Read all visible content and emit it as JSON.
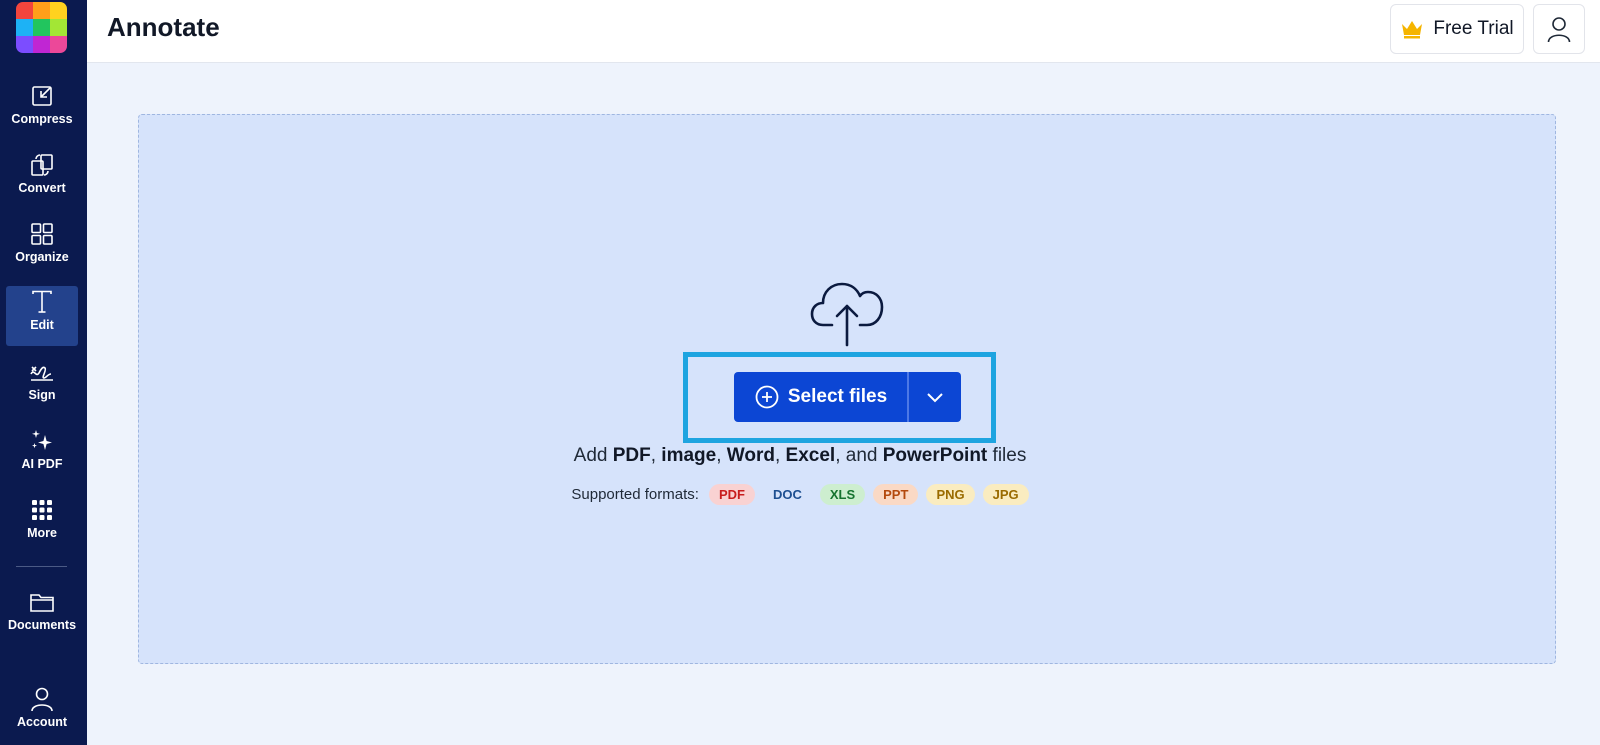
{
  "app": {
    "title": "Annotate"
  },
  "sidebar": {
    "logo_colors": [
      "#f2453d",
      "#ff9f1a",
      "#ffd21f",
      "#1db2f5",
      "#22c55e",
      "#a3e635",
      "#7c4dff",
      "#c026d3",
      "#ec4899"
    ],
    "items": [
      {
        "label": "Compress",
        "icon": "compress-icon"
      },
      {
        "label": "Convert",
        "icon": "convert-icon"
      },
      {
        "label": "Organize",
        "icon": "organize-icon"
      },
      {
        "label": "Edit",
        "icon": "edit-text-icon",
        "active": true
      },
      {
        "label": "Sign",
        "icon": "signature-icon"
      },
      {
        "label": "AI PDF",
        "icon": "sparkle-icon"
      },
      {
        "label": "More",
        "icon": "grid-dots-icon"
      },
      {
        "label": "Documents",
        "icon": "folder-icon"
      },
      {
        "label": "Account",
        "icon": "user-icon"
      }
    ]
  },
  "header": {
    "trial_label": "Free Trial",
    "trial_icon": "crown-icon",
    "user_icon": "user-icon"
  },
  "upload": {
    "cloud_icon": "cloud-upload-icon",
    "select_label": "Select files",
    "add_text": {
      "pre": "Add",
      "pdf": "PDF",
      "image": "image",
      "word": "Word",
      "excel": "Excel",
      "and": "and",
      "powerpoint": "PowerPoint",
      "post": "files"
    },
    "formats_label": "Supported formats:",
    "formats": [
      {
        "label": "PDF",
        "bg": "#f9d2d2",
        "color": "#c81e1e"
      },
      {
        "label": "DOC",
        "bg": "#d6e3fb",
        "color": "#1d4f91"
      },
      {
        "label": "XLS",
        "bg": "#cdeecf",
        "color": "#16732f"
      },
      {
        "label": "PPT",
        "bg": "#fad9c5",
        "color": "#b4490d"
      },
      {
        "label": "PNG",
        "bg": "#faecc0",
        "color": "#9a6b00"
      },
      {
        "label": "JPG",
        "bg": "#faecc0",
        "color": "#9a6b00"
      }
    ]
  },
  "colors": {
    "sidebar_bg": "#0b1a4f",
    "sidebar_active": "#23428c",
    "primary": "#0c46d4",
    "highlight": "#1ea4e0",
    "dropzone_bg": "#d6e3fb",
    "crown": "#f5b400"
  }
}
